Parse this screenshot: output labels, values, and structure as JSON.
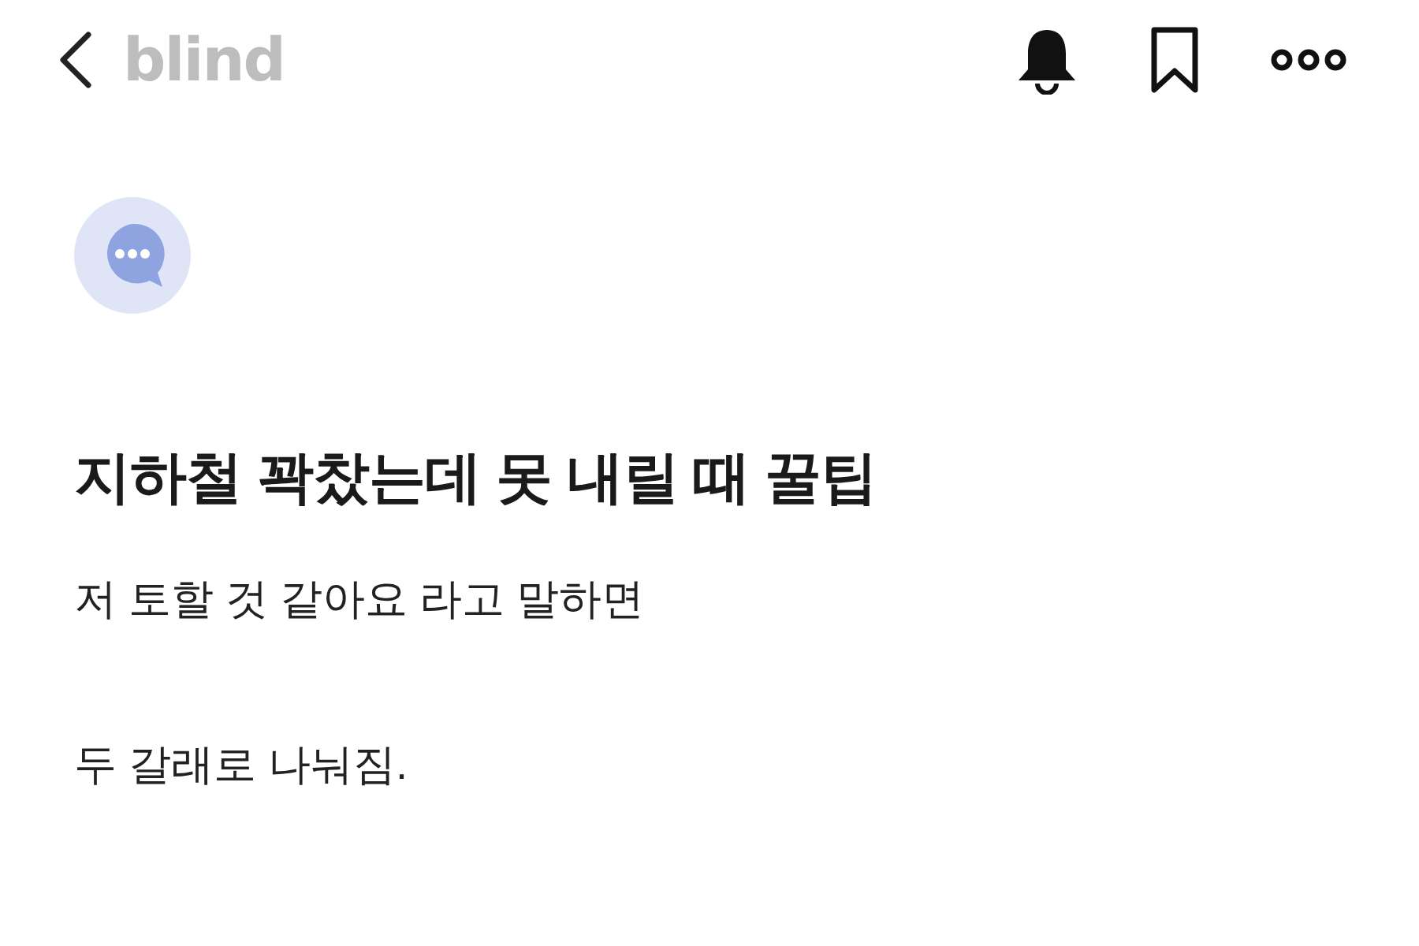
{
  "header": {
    "logo": "blind"
  },
  "post": {
    "title": "지하철 꽉찼는데 못 내릴 때 꿀팁",
    "paragraphs": [
      "저 토할 것 같아요 라고 말하면",
      "두 갈래로 나눠짐."
    ]
  }
}
